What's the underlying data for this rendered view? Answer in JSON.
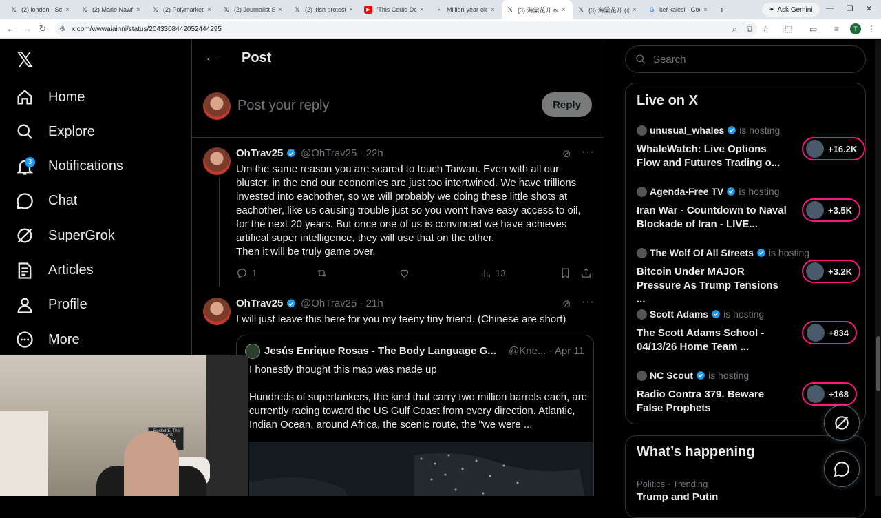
{
  "browser": {
    "tabs": [
      {
        "title": "(2) london - Se",
        "favicon": "x-logo"
      },
      {
        "title": "(2) Mario Nawfa",
        "favicon": "x-logo"
      },
      {
        "title": "(2) Polymarket",
        "favicon": "x-logo"
      },
      {
        "title": "(2) Journalist Sa",
        "favicon": "x-logo"
      },
      {
        "title": "(2) irish protest",
        "favicon": "x-logo"
      },
      {
        "title": "\"This Could Des",
        "favicon": "youtube-icon"
      },
      {
        "title": "Million-year-old",
        "favicon": "page-icon"
      },
      {
        "title": "(3) 海棠花开 on",
        "favicon": "x-logo",
        "active": true
      },
      {
        "title": "(3) 海棠花开 (@",
        "favicon": "x-logo"
      },
      {
        "title": "kef kalesi - Goo",
        "favicon": "google-icon"
      }
    ],
    "new_tab": "+",
    "gemini_label": "Ask Gemini",
    "url": "x.com/wwwaiainni/status/2043308442052444295",
    "account_initial": "T"
  },
  "nav": {
    "items": [
      {
        "label": "Home",
        "icon": "home-icon"
      },
      {
        "label": "Explore",
        "icon": "search-icon"
      },
      {
        "label": "Notifications",
        "icon": "bell-icon",
        "badge": "3"
      },
      {
        "label": "Chat",
        "icon": "chat-icon"
      },
      {
        "label": "SuperGrok",
        "icon": "grok-icon"
      },
      {
        "label": "Articles",
        "icon": "articles-icon"
      },
      {
        "label": "Profile",
        "icon": "person-icon"
      },
      {
        "label": "More",
        "icon": "more-circle-icon"
      }
    ]
  },
  "main": {
    "title": "Post",
    "reply_placeholder": "Post your reply",
    "reply_button": "Reply",
    "posts": [
      {
        "name": "OhTrav25",
        "handle": "@OhTrav25 · 22h",
        "text": "Um the same reason you are scared to touch Taiwan. Even with all our bluster, in the end our economies are just too intertwined. We have trillions invested into eachother, so we will probably we doing these little shots at eachother, like us causing trouble just so you won't have easy access to oil, for the next 20 years. But once one of us is convinced we have achieves artifical super intelligence, they will use that on the other.\nThen it will be truly game over.",
        "replies": "1",
        "views": "13"
      },
      {
        "name": "OhTrav25",
        "handle": "@OhTrav25 · 21h",
        "text": "I will just leave this here for you my teeny tiny friend. (Chinese are short)"
      }
    ],
    "quote": {
      "name": "Jesús Enrique Rosas - The Body Language G...",
      "handle": "@Kne... · Apr 11",
      "line1": "I honestly thought this map was made up",
      "line2": "Hundreds of supertankers, the kind that carry two million barrels each, are currently racing toward the US Gulf Coast from  every direction. Atlantic, Indian Ocean, around Africa, the scenic route, the \"we were ..."
    }
  },
  "sidebar": {
    "search_placeholder": "Search",
    "live_title": "Live on X",
    "hosting_label": "is hosting",
    "live": [
      {
        "host": "unusual_whales",
        "title": "WhaleWatch: Live Options Flow and Futures Trading o...",
        "count": "+16.2K"
      },
      {
        "host": "Agenda-Free TV",
        "title": "Iran War - Countdown to Naval Blockade of Iran - LIVE...",
        "count": "+3.5K"
      },
      {
        "host": "The Wolf Of All Streets",
        "title": "Bitcoin Under MAJOR Pressure As Trump Tensions ...",
        "count": "+3.2K"
      },
      {
        "host": "Scott Adams",
        "title": "The Scott Adams School - 04/13/26  Home Team ...",
        "count": "+834"
      },
      {
        "host": "NC Scout",
        "title": "Radio Contra 379. Beware False Prophets",
        "count": "+168"
      }
    ],
    "happening_title": "What’s happening",
    "happening_meta": "Politics · Trending",
    "happening_topic": "Trump and Putin"
  },
  "webcam": {
    "sign_line1": "Rocket E. The Hermit",
    "sign_line2": "OhTrav25"
  },
  "colors": {
    "accent": "#1d9bf0",
    "live_ring": "#f91880",
    "background": "#000000",
    "muted": "#71767b"
  }
}
